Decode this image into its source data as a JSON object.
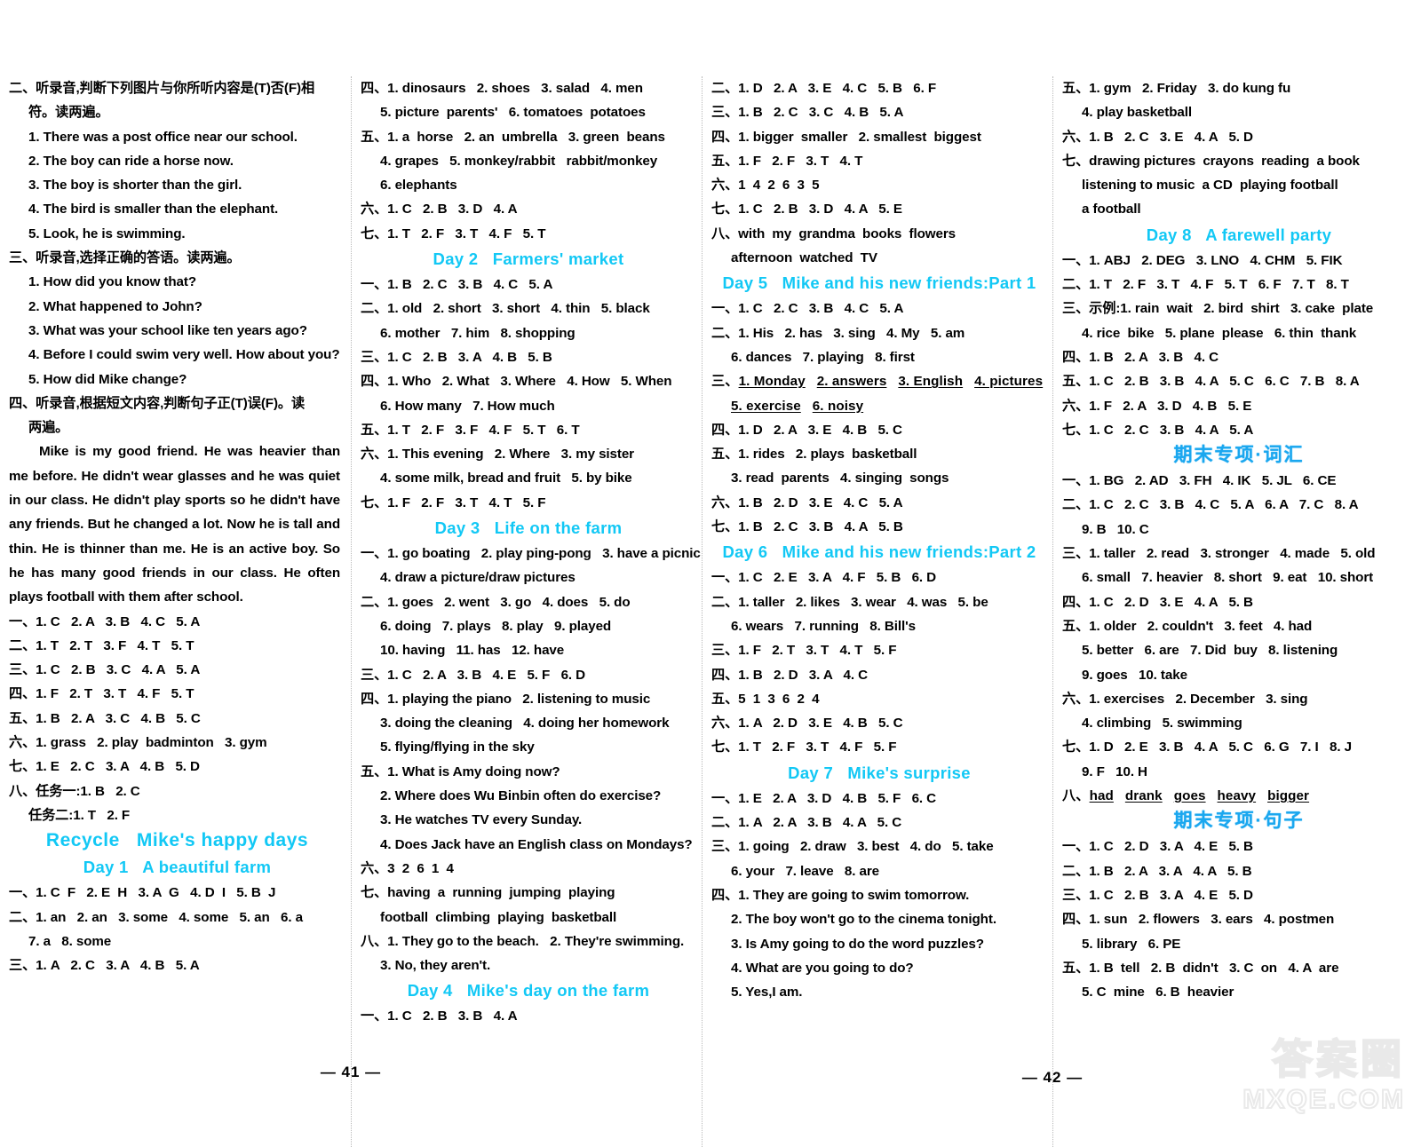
{
  "document": {
    "page_numbers": {
      "left": "— 41 —",
      "right": "— 42 —"
    },
    "watermark": {
      "cn": "答案圈",
      "url": "MXQE.COM"
    }
  },
  "columns": [
    {
      "id": "column-1",
      "blocks": [
        {
          "type": "line",
          "text": "二、听录音,判断下列图片与你所听内容是(T)否(F)相"
        },
        {
          "type": "line",
          "indent": 1,
          "text": "符。读两遍。"
        },
        {
          "type": "line",
          "indent": 1,
          "text": "1. There was a post office near our school."
        },
        {
          "type": "line",
          "indent": 1,
          "text": "2. The boy can ride a horse now."
        },
        {
          "type": "line",
          "indent": 1,
          "text": "3. The boy is shorter than the girl."
        },
        {
          "type": "line",
          "indent": 1,
          "text": "4. The bird is smaller than the elephant."
        },
        {
          "type": "line",
          "indent": 1,
          "text": "5. Look, he is swimming."
        },
        {
          "type": "line",
          "text": "三、听录音,选择正确的答语。读两遍。"
        },
        {
          "type": "line",
          "indent": 1,
          "text": "1. How did you know that?"
        },
        {
          "type": "line",
          "indent": 1,
          "text": "2. What happened to John?"
        },
        {
          "type": "line",
          "indent": 1,
          "text": "3. What was your school like ten years ago?"
        },
        {
          "type": "line",
          "indent": 1,
          "text": "4. Before I could swim very well. How about you?"
        },
        {
          "type": "line",
          "indent": 1,
          "text": "5. How did Mike change?"
        },
        {
          "type": "line",
          "text": "四、听录音,根据短文内容,判断句子正(T)误(F)。读"
        },
        {
          "type": "line",
          "indent": 1,
          "text": "两遍。"
        },
        {
          "type": "para",
          "text": "Mike is my good friend. He was heavier than me before. He didn't wear glasses and he was quiet in our class. He didn't play sports so he didn't have any friends. But he changed a lot. Now he is tall and thin. He is thinner than me. He is an active boy. So he has many good friends in our class. He often plays football with them after school."
        },
        {
          "type": "line",
          "text": "一、1. C   2. A   3. B   4. C   5. A"
        },
        {
          "type": "line",
          "text": "二、1. T   2. T   3. F   4. T   5. T"
        },
        {
          "type": "line",
          "text": "三、1. C   2. B   3. C   4. A   5. A"
        },
        {
          "type": "line",
          "text": "四、1. F   2. T   3. T   4. F   5. T"
        },
        {
          "type": "line",
          "text": "五、1. B   2. A   3. C   4. B   5. C"
        },
        {
          "type": "line",
          "text": "六、1. grass   2. play  badminton   3. gym"
        },
        {
          "type": "line",
          "text": "七、1. E   2. C   3. A   4. B   5. D"
        },
        {
          "type": "line",
          "text": "八、任务一:1. B   2. C"
        },
        {
          "type": "line",
          "indent": 1,
          "text": "任务二:1. T   2. F"
        },
        {
          "type": "heading",
          "size": "big",
          "text": "Recycle   Mike's happy days"
        },
        {
          "type": "heading",
          "text": "Day 1   A beautiful farm"
        },
        {
          "type": "line",
          "text": "一、1. C  F   2. E  H   3. A  G   4. D  I   5. B  J"
        },
        {
          "type": "line",
          "text": "二、1. an   2. an   3. some   4. some   5. an   6. a"
        },
        {
          "type": "line",
          "indent": 1,
          "text": "7. a   8. some"
        },
        {
          "type": "line",
          "text": "三、1. A   2. C   3. A   4. B   5. A"
        }
      ]
    },
    {
      "id": "column-2",
      "blocks": [
        {
          "type": "line",
          "text": "四、1. dinosaurs   2. shoes   3. salad   4. men"
        },
        {
          "type": "line",
          "indent": 1,
          "text": "5. picture  parents'   6. tomatoes  potatoes"
        },
        {
          "type": "line",
          "text": "五、1. a  horse   2. an  umbrella   3. green  beans"
        },
        {
          "type": "line",
          "indent": 1,
          "text": "4. grapes   5. monkey/rabbit   rabbit/monkey"
        },
        {
          "type": "line",
          "indent": 1,
          "text": "6. elephants"
        },
        {
          "type": "line",
          "text": "六、1. C   2. B   3. D   4. A"
        },
        {
          "type": "line",
          "text": "七、1. T   2. F   3. T   4. F   5. T"
        },
        {
          "type": "heading",
          "text": "Day 2   Farmers' market"
        },
        {
          "type": "line",
          "text": "一、1. B   2. C   3. B   4. C   5. A"
        },
        {
          "type": "line",
          "text": "二、1. old   2. short   3. short   4. thin   5. black"
        },
        {
          "type": "line",
          "indent": 1,
          "text": "6. mother   7. him   8. shopping"
        },
        {
          "type": "line",
          "text": "三、1. C   2. B   3. A   4. B   5. B"
        },
        {
          "type": "line",
          "text": "四、1. Who   2. What   3. Where   4. How   5. When"
        },
        {
          "type": "line",
          "indent": 1,
          "text": "6. How many   7. How much"
        },
        {
          "type": "line",
          "text": "五、1. T   2. F   3. F   4. F   5. T   6. T"
        },
        {
          "type": "line",
          "text": "六、1. This evening   2. Where   3. my sister"
        },
        {
          "type": "line",
          "indent": 1,
          "text": "4. some milk, bread and fruit   5. by bike"
        },
        {
          "type": "line",
          "text": "七、1. F   2. F   3. T   4. T   5. F"
        },
        {
          "type": "heading",
          "text": "Day 3   Life on the farm"
        },
        {
          "type": "line",
          "text": "一、1. go boating   2. play ping-pong   3. have a picnic"
        },
        {
          "type": "line",
          "indent": 1,
          "text": "4. draw a picture/draw pictures"
        },
        {
          "type": "line",
          "text": "二、1. goes   2. went   3. go   4. does   5. do"
        },
        {
          "type": "line",
          "indent": 1,
          "text": "6. doing   7. plays   8. play   9. played"
        },
        {
          "type": "line",
          "indent": 1,
          "text": "10. having   11. has   12. have"
        },
        {
          "type": "line",
          "text": "三、1. C   2. A   3. B   4. E   5. F   6. D"
        },
        {
          "type": "line",
          "text": "四、1. playing the piano   2. listening to music"
        },
        {
          "type": "line",
          "indent": 1,
          "text": "3. doing the cleaning   4. doing her homework"
        },
        {
          "type": "line",
          "indent": 1,
          "text": "5. flying/flying in the sky"
        },
        {
          "type": "line",
          "text": "五、1. What is Amy doing now?"
        },
        {
          "type": "line",
          "indent": 1,
          "text": "2. Where does Wu Binbin often do exercise?"
        },
        {
          "type": "line",
          "indent": 1,
          "text": "3. He watches TV every Sunday."
        },
        {
          "type": "line",
          "indent": 1,
          "text": "4. Does Jack have an English class on Mondays?"
        },
        {
          "type": "line",
          "text": "六、3  2  6  1  4"
        },
        {
          "type": "line",
          "text": "七、having  a  running  jumping  playing"
        },
        {
          "type": "line",
          "indent": 1,
          "text": "football  climbing  playing  basketball"
        },
        {
          "type": "line",
          "text": "八、1. They go to the beach.   2. They're swimming."
        },
        {
          "type": "line",
          "indent": 1,
          "text": "3. No, they aren't."
        },
        {
          "type": "heading",
          "text": "Day 4   Mike's day on the farm"
        },
        {
          "type": "line",
          "text": "一、1. C   2. B   3. B   4. A"
        }
      ]
    },
    {
      "id": "column-3",
      "blocks": [
        {
          "type": "line",
          "text": "二、1. D   2. A   3. E   4. C   5. B   6. F"
        },
        {
          "type": "line",
          "text": "三、1. B   2. C   3. C   4. B   5. A"
        },
        {
          "type": "line",
          "text": "四、1. bigger  smaller   2. smallest  biggest"
        },
        {
          "type": "line",
          "text": "五、1. F   2. F   3. T   4. T"
        },
        {
          "type": "line",
          "text": "六、1  4  2  6  3  5"
        },
        {
          "type": "line",
          "text": "七、1. C   2. B   3. D   4. A   5. E"
        },
        {
          "type": "line",
          "text": "八、with  my  grandma  books  flowers"
        },
        {
          "type": "line",
          "indent": 1,
          "text": "afternoon  watched  TV"
        },
        {
          "type": "heading",
          "text": "Day 5   Mike and his new friends:Part 1"
        },
        {
          "type": "line",
          "text": "一、1. C   2. C   3. B   4. C   5. A"
        },
        {
          "type": "line",
          "text": "二、1. His   2. has   3. sing   4. My   5. am"
        },
        {
          "type": "line",
          "indent": 1,
          "text": "6. dances   7. playing   8. first"
        },
        {
          "type": "underline-line",
          "prefix": "三、",
          "items": [
            "1. Monday",
            "2. answers",
            "3. English",
            "4. pictures"
          ]
        },
        {
          "type": "underline-line",
          "prefix": "",
          "indent": 1,
          "items": [
            "5. exercise",
            "6. noisy"
          ]
        },
        {
          "type": "line",
          "text": "四、1. D   2. A   3. E   4. B   5. C"
        },
        {
          "type": "line",
          "text": "五、1. rides   2. plays  basketball"
        },
        {
          "type": "line",
          "indent": 1,
          "text": "3. read  parents   4. singing  songs"
        },
        {
          "type": "line",
          "text": "六、1. B   2. D   3. E   4. C   5. A"
        },
        {
          "type": "line",
          "text": "七、1. B   2. C   3. B   4. A   5. B"
        },
        {
          "type": "heading",
          "text": "Day 6   Mike and his new friends:Part 2"
        },
        {
          "type": "line",
          "text": "一、1. C   2. E   3. A   4. F   5. B   6. D"
        },
        {
          "type": "line",
          "text": "二、1. taller   2. likes   3. wear   4. was   5. be"
        },
        {
          "type": "line",
          "indent": 1,
          "text": "6. wears   7. running   8. Bill's"
        },
        {
          "type": "line",
          "text": "三、1. F   2. T   3. T   4. T   5. F"
        },
        {
          "type": "line",
          "text": "四、1. B   2. D   3. A   4. C"
        },
        {
          "type": "line",
          "text": "五、5  1  3  6  2  4"
        },
        {
          "type": "line",
          "text": "六、1. A   2. D   3. E   4. B   5. C"
        },
        {
          "type": "line",
          "text": "七、1. T   2. F   3. T   4. F   5. F"
        },
        {
          "type": "heading",
          "text": "Day 7   Mike's surprise"
        },
        {
          "type": "line",
          "text": "一、1. E   2. A   3. D   4. B   5. F   6. C"
        },
        {
          "type": "line",
          "text": "二、1. A   2. A   3. B   4. A   5. C"
        },
        {
          "type": "line",
          "text": "三、1. going   2. draw   3. best   4. do   5. take"
        },
        {
          "type": "line",
          "indent": 1,
          "text": "6. your   7. leave   8. are"
        },
        {
          "type": "line",
          "text": "四、1. They are going to swim tomorrow."
        },
        {
          "type": "line",
          "indent": 1,
          "text": "2. The boy won't go to the cinema tonight."
        },
        {
          "type": "line",
          "indent": 1,
          "text": "3. Is Amy going to do the word puzzles?"
        },
        {
          "type": "line",
          "indent": 1,
          "text": "4. What are you going to do?"
        },
        {
          "type": "line",
          "indent": 1,
          "text": "5. Yes,I am."
        }
      ]
    },
    {
      "id": "column-4",
      "blocks": [
        {
          "type": "line",
          "text": "五、1. gym   2. Friday   3. do kung fu"
        },
        {
          "type": "line",
          "indent": 1,
          "text": "4. play basketball"
        },
        {
          "type": "line",
          "text": "六、1. B   2. C   3. E   4. A   5. D"
        },
        {
          "type": "line",
          "text": "七、drawing pictures  crayons  reading  a book"
        },
        {
          "type": "line",
          "indent": 1,
          "text": "listening to music  a CD  playing football"
        },
        {
          "type": "line",
          "indent": 1,
          "text": "a football"
        },
        {
          "type": "heading",
          "text": "Day 8   A farewell party"
        },
        {
          "type": "line",
          "text": "一、1. ABJ   2. DEG   3. LNO   4. CHM   5. FIK"
        },
        {
          "type": "line",
          "text": "二、1. T   2. F   3. T   4. F   5. T   6. F   7. T   8. T"
        },
        {
          "type": "line",
          "text": "三、示例:1. rain  wait   2. bird  shirt   3. cake  plate"
        },
        {
          "type": "line",
          "indent": 1,
          "text": "4. rice  bike   5. plane  please   6. thin  thank"
        },
        {
          "type": "line",
          "text": "四、1. B   2. A   3. B   4. C"
        },
        {
          "type": "line",
          "text": "五、1. C   2. B   3. B   4. A   5. C   6. C   7. B   8. A"
        },
        {
          "type": "line",
          "text": "六、1. F   2. A   3. D   4. B   5. E"
        },
        {
          "type": "line",
          "text": "七、1. C   2. C   3. B   4. A   5. A"
        },
        {
          "type": "heading",
          "style": "cn",
          "text": "期末专项·词汇"
        },
        {
          "type": "line",
          "text": "一、1. BG   2. AD   3. FH   4. IK   5. JL   6. CE"
        },
        {
          "type": "line",
          "text": "二、1. C   2. C   3. B   4. C   5. A   6. A   7. C   8. A"
        },
        {
          "type": "line",
          "indent": 1,
          "text": "9. B   10. C"
        },
        {
          "type": "line",
          "text": "三、1. taller   2. read   3. stronger   4. made   5. old"
        },
        {
          "type": "line",
          "indent": 1,
          "text": "6. small   7. heavier   8. short   9. eat   10. short"
        },
        {
          "type": "line",
          "text": "四、1. C   2. D   3. E   4. A   5. B"
        },
        {
          "type": "line",
          "text": "五、1. older   2. couldn't   3. feet   4. had"
        },
        {
          "type": "line",
          "indent": 1,
          "text": "5. better   6. are   7. Did  buy   8. listening"
        },
        {
          "type": "line",
          "indent": 1,
          "text": "9. goes   10. take"
        },
        {
          "type": "line",
          "text": "六、1. exercises   2. December   3. sing"
        },
        {
          "type": "line",
          "indent": 1,
          "text": "4. climbing   5. swimming"
        },
        {
          "type": "line",
          "text": "七、1. D   2. E   3. B   4. A   5. C   6. G   7. I   8. J"
        },
        {
          "type": "line",
          "indent": 1,
          "text": "9. F   10. H"
        },
        {
          "type": "underline-line",
          "prefix": "八、",
          "items": [
            "had",
            "drank",
            "goes",
            "heavy",
            "bigger"
          ]
        },
        {
          "type": "heading",
          "style": "cn",
          "text": "期末专项·句子"
        },
        {
          "type": "line",
          "text": "一、1. C   2. D   3. A   4. E   5. B"
        },
        {
          "type": "line",
          "text": "二、1. B   2. A   3. A   4. A   5. B"
        },
        {
          "type": "line",
          "text": "三、1. C   2. B   3. A   4. E   5. D"
        },
        {
          "type": "line",
          "text": "四、1. sun   2. flowers   3. ears   4. postmen"
        },
        {
          "type": "line",
          "indent": 1,
          "text": "5. library   6. PE"
        },
        {
          "type": "line",
          "text": "五、1. B  tell   2. B  didn't   3. C  on   4. A  are"
        },
        {
          "type": "line",
          "indent": 1,
          "text": "5. C  mine   6. B  heavier"
        }
      ]
    }
  ]
}
